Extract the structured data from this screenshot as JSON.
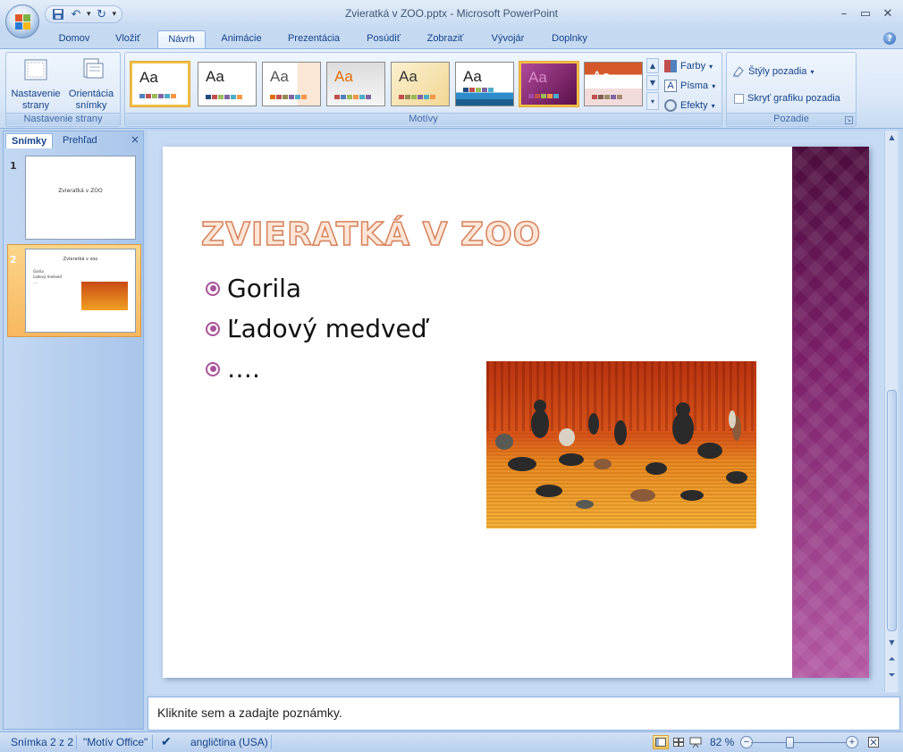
{
  "window": {
    "title": "Zvieratká v ZOO.pptx - Microsoft PowerPoint",
    "minimize": "–",
    "maximize": "▭",
    "close": "✕"
  },
  "tabs": [
    "Domov",
    "Vložiť",
    "Návrh",
    "Animácie",
    "Prezentácia",
    "Posúdiť",
    "Zobraziť",
    "Vývojár",
    "Doplnky"
  ],
  "active_tab": "Návrh",
  "ribbon": {
    "page_setup": {
      "setup_label": "Nastavenie strany",
      "orientation_label": "Orientácia snímky",
      "group_label": "Nastavenie strany"
    },
    "themes": {
      "group_label": "Motívy",
      "theme_text": "Aa",
      "colors_label": "Farby",
      "fonts_label": "Písma",
      "effects_label": "Efekty"
    },
    "background": {
      "styles_label": "Štýly pozadia",
      "hide_graphics_label": "Skryť grafiku pozadia",
      "group_label": "Pozadie"
    }
  },
  "left_pane": {
    "tab_slides": "Snímky",
    "tab_outline": "Prehľad",
    "close": "×",
    "slides": [
      {
        "number": "1",
        "title": "Zvieratká v ZOO"
      },
      {
        "number": "2",
        "title": "Zvieratká v zoo",
        "bullets": [
          "Gorila",
          "Ľadový medveď",
          "...."
        ]
      }
    ]
  },
  "slide": {
    "title": "ZVIERATKÁ V ZOO",
    "bullets": [
      "Gorila",
      "Ľadový medveď",
      "…."
    ]
  },
  "notes": {
    "placeholder": "Kliknite sem a zadajte poznámky."
  },
  "status": {
    "slide_counter": "Snímka 2 z 2",
    "theme_name": "\"Motív Office\"",
    "language": "angličtina (USA)",
    "zoom": "82 %"
  },
  "colors": {
    "title_fill": "#fde6d8",
    "title_stroke": "#d6805a",
    "band_dark": "#4a0c3c",
    "band_light": "#b45aa5",
    "bullet_color": "#a8549a"
  }
}
